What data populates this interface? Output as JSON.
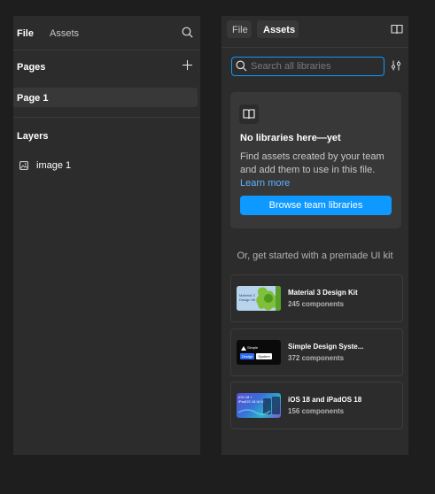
{
  "left_panel": {
    "tabs": {
      "file": "File",
      "assets": "Assets"
    },
    "pages_title": "Pages",
    "pages": [
      {
        "label": "Page 1"
      }
    ],
    "layers_title": "Layers",
    "layers": [
      {
        "label": "image 1",
        "icon": "image-icon"
      }
    ]
  },
  "right_panel": {
    "tabs": {
      "file": "File",
      "assets": "Assets"
    },
    "search": {
      "placeholder": "Search all libraries",
      "value": ""
    },
    "empty_state": {
      "icon": "library-book-icon",
      "title": "No libraries here—yet",
      "description": "Find assets created by your team and add them to use in this file.",
      "link": "Learn more",
      "button": "Browse team libraries"
    },
    "kits_heading": "Or, get started with a premade UI kit",
    "kits": [
      {
        "name": "Material 3 Design Kit",
        "count": "245 components",
        "thumb_label": "Material 3 Design Kit"
      },
      {
        "name": "Simple Design Syste...",
        "count": "372 components",
        "thumb_label_1": "Simple",
        "thumb_label_2": "Design",
        "thumb_label_3": "System"
      },
      {
        "name": "iOS 18 and iPadOS 18",
        "count": "156 components",
        "thumb_label": "iOS 18 + iPadOS 18 Ul Kit"
      }
    ]
  },
  "colors": {
    "accent": "#0d99ff",
    "link": "#5cb2ff",
    "panel": "#2c2c2c",
    "background": "#1e1e1e"
  }
}
